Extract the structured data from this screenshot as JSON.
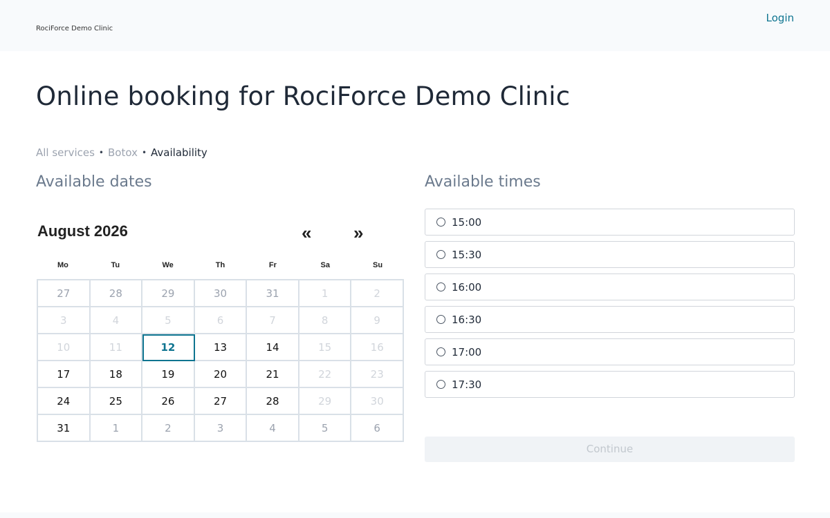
{
  "header": {
    "clinic_name": "RociForce Demo Clinic",
    "login_label": "Login"
  },
  "page_title": "Online booking for RociForce Demo Clinic",
  "breadcrumb": {
    "all_services": "All services",
    "sep": "•",
    "service": "Botox",
    "current": "Availability"
  },
  "dates_title": "Available dates",
  "times_title": "Available times",
  "calendar": {
    "month_label": "August 2026",
    "prev": "«",
    "next": "»",
    "weekdays": [
      "Mo",
      "Tu",
      "We",
      "Th",
      "Fr",
      "Sa",
      "Su"
    ],
    "days": [
      {
        "label": "27",
        "state": "other"
      },
      {
        "label": "28",
        "state": "other"
      },
      {
        "label": "29",
        "state": "other"
      },
      {
        "label": "30",
        "state": "other"
      },
      {
        "label": "31",
        "state": "other"
      },
      {
        "label": "1",
        "state": "disabled"
      },
      {
        "label": "2",
        "state": "disabled"
      },
      {
        "label": "3",
        "state": "disabled"
      },
      {
        "label": "4",
        "state": "disabled"
      },
      {
        "label": "5",
        "state": "disabled"
      },
      {
        "label": "6",
        "state": "disabled"
      },
      {
        "label": "7",
        "state": "disabled"
      },
      {
        "label": "8",
        "state": "disabled"
      },
      {
        "label": "9",
        "state": "disabled"
      },
      {
        "label": "10",
        "state": "disabled"
      },
      {
        "label": "11",
        "state": "disabled"
      },
      {
        "label": "12",
        "state": "selected"
      },
      {
        "label": "13",
        "state": "available"
      },
      {
        "label": "14",
        "state": "available"
      },
      {
        "label": "15",
        "state": "disabled"
      },
      {
        "label": "16",
        "state": "disabled"
      },
      {
        "label": "17",
        "state": "available"
      },
      {
        "label": "18",
        "state": "available"
      },
      {
        "label": "19",
        "state": "available"
      },
      {
        "label": "20",
        "state": "available"
      },
      {
        "label": "21",
        "state": "available"
      },
      {
        "label": "22",
        "state": "disabled"
      },
      {
        "label": "23",
        "state": "disabled"
      },
      {
        "label": "24",
        "state": "available"
      },
      {
        "label": "25",
        "state": "available"
      },
      {
        "label": "26",
        "state": "available"
      },
      {
        "label": "27",
        "state": "available"
      },
      {
        "label": "28",
        "state": "available"
      },
      {
        "label": "29",
        "state": "disabled"
      },
      {
        "label": "30",
        "state": "disabled"
      },
      {
        "label": "31",
        "state": "available"
      },
      {
        "label": "1",
        "state": "other"
      },
      {
        "label": "2",
        "state": "other"
      },
      {
        "label": "3",
        "state": "other"
      },
      {
        "label": "4",
        "state": "other"
      },
      {
        "label": "5",
        "state": "other"
      },
      {
        "label": "6",
        "state": "other"
      }
    ]
  },
  "times": [
    "15:00",
    "15:30",
    "16:00",
    "16:30",
    "17:00",
    "17:30"
  ],
  "continue_label": "Continue",
  "colors": {
    "accent": "#0e7490",
    "muted": "#9ca3af",
    "disabled": "#d1d5db"
  }
}
